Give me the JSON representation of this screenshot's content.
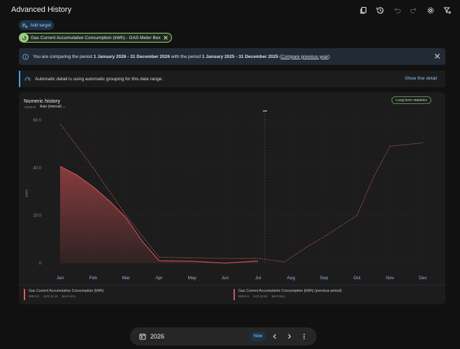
{
  "header": {
    "title": "Advanced History"
  },
  "toolbar": {
    "icons": [
      "copy-icon",
      "history-icon",
      "undo-icon",
      "redo-icon",
      "settings-icon",
      "clear-filter-icon"
    ]
  },
  "add_target": {
    "label": "Add target"
  },
  "target_chip": {
    "label": "Gas Current Accumulative Consumption (kWh) - GAS Meter Box"
  },
  "banner": {
    "prefix": "You are comparing the period ",
    "period1": "1 January 2026 - 31 December 2026",
    "mid": " with the period ",
    "period2": "1 January 2025 - 31 December 2025",
    "link_open": " (",
    "link": "Compare previous year",
    "link_close": ")"
  },
  "auto_detail": {
    "text": "Automatic detail is using automatic grouping for this date range.",
    "action": "Show fine detail"
  },
  "card": {
    "title": "Numeric history",
    "group_label": "GROUP",
    "group_value": "Auto (interval)",
    "badge": "Long-term statistics"
  },
  "colors": {
    "current": "#e0575c",
    "previous": "#c95a66",
    "accent": "#3da6ff"
  },
  "chart_data": {
    "type": "line",
    "categories": [
      "Jan",
      "Feb",
      "Mar",
      "Apr",
      "May",
      "Jun",
      "Jul",
      "Aug",
      "Sep",
      "Oct",
      "Nov",
      "Dec"
    ],
    "ylabel": "kWh",
    "ylim": [
      0,
      60
    ],
    "yticks": [
      "0",
      "20.0",
      "40.0",
      "60.0"
    ],
    "series": [
      {
        "name": "Gas Current Accumulative Consumption (kWh)",
        "x": [
          0,
          0.5,
          1,
          1.5,
          2,
          2.5,
          3,
          4,
          5,
          6
        ],
        "values": [
          40.6,
          37,
          32,
          26,
          19,
          9,
          1,
          0.8,
          0,
          0.9
        ]
      },
      {
        "name": "Gas Current Accumulative Consumption (kWh) (previous period)",
        "x": [
          0,
          1,
          2,
          3,
          4,
          5,
          6,
          6.8,
          7.5,
          8,
          9,
          9.5,
          10,
          11
        ],
        "values": [
          58.5,
          40,
          20,
          2.5,
          2.2,
          2,
          2,
          0.5,
          7,
          11,
          20,
          36,
          49,
          50.5
        ]
      }
    ]
  },
  "legend": [
    {
      "name": "Gas Current Accumulative Consumption (kWh)",
      "min": "MIN 0.0",
      "avg": "AVG 14.15",
      "max": "MAX 40.6"
    },
    {
      "name": "Gas Current Accumulative Consumption (kWh) (previous period)",
      "min": "MIN 0.6",
      "avg": "AVG 22.51",
      "max": "MAX 58.5"
    }
  ],
  "bottom": {
    "year": "2026",
    "now": "Now"
  }
}
